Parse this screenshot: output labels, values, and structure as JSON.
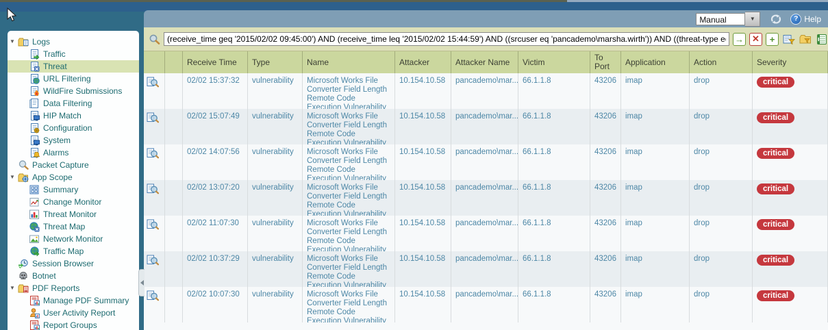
{
  "toolbar": {
    "refresh_mode_value": "Manual",
    "help_label": "Help"
  },
  "filter": {
    "query": "(receive_time geq '2015/02/02 09:45:00') AND (receive_time leq '2015/02/02 15:44:59') AND ((srcuser eq 'pancademo\\marsha.wirth')) AND ((threat-type eq vulnerability)) A",
    "icons": [
      "search-icon",
      "apply-filter-icon",
      "clear-filter-icon",
      "add-filter-icon",
      "save-filter-icon",
      "load-filter-icon",
      "export-icon"
    ]
  },
  "sidebar": {
    "items": [
      {
        "label": "Logs",
        "level": 0,
        "icon": "logs-folder-icon",
        "expander": true,
        "selected": false
      },
      {
        "label": "Traffic",
        "level": 1,
        "icon": "traffic-icon",
        "expander": false,
        "selected": false
      },
      {
        "label": "Threat",
        "level": 1,
        "icon": "threat-icon",
        "expander": false,
        "selected": true
      },
      {
        "label": "URL Filtering",
        "level": 1,
        "icon": "url-filtering-icon",
        "expander": false,
        "selected": false
      },
      {
        "label": "WildFire Submissions",
        "level": 1,
        "icon": "wildfire-icon",
        "expander": false,
        "selected": false
      },
      {
        "label": "Data Filtering",
        "level": 1,
        "icon": "data-filtering-icon",
        "expander": false,
        "selected": false
      },
      {
        "label": "HIP Match",
        "level": 1,
        "icon": "hip-match-icon",
        "expander": false,
        "selected": false
      },
      {
        "label": "Configuration",
        "level": 1,
        "icon": "configuration-icon",
        "expander": false,
        "selected": false
      },
      {
        "label": "System",
        "level": 1,
        "icon": "system-icon",
        "expander": false,
        "selected": false
      },
      {
        "label": "Alarms",
        "level": 1,
        "icon": "alarms-icon",
        "expander": false,
        "selected": false
      },
      {
        "label": "Packet Capture",
        "level": 0,
        "icon": "packet-capture-icon",
        "expander": false,
        "selected": false
      },
      {
        "label": "App Scope",
        "level": 0,
        "icon": "app-scope-folder-icon",
        "expander": true,
        "selected": false
      },
      {
        "label": "Summary",
        "level": 1,
        "icon": "summary-icon",
        "expander": false,
        "selected": false
      },
      {
        "label": "Change Monitor",
        "level": 1,
        "icon": "change-monitor-icon",
        "expander": false,
        "selected": false
      },
      {
        "label": "Threat Monitor",
        "level": 1,
        "icon": "threat-monitor-icon",
        "expander": false,
        "selected": false
      },
      {
        "label": "Threat Map",
        "level": 1,
        "icon": "threat-map-icon",
        "expander": false,
        "selected": false
      },
      {
        "label": "Network Monitor",
        "level": 1,
        "icon": "network-monitor-icon",
        "expander": false,
        "selected": false
      },
      {
        "label": "Traffic Map",
        "level": 1,
        "icon": "traffic-map-icon",
        "expander": false,
        "selected": false
      },
      {
        "label": "Session Browser",
        "level": 0,
        "icon": "session-browser-icon",
        "expander": false,
        "selected": false
      },
      {
        "label": "Botnet",
        "level": 0,
        "icon": "botnet-icon",
        "expander": false,
        "selected": false
      },
      {
        "label": "PDF Reports",
        "level": 0,
        "icon": "pdf-reports-folder-icon",
        "expander": true,
        "selected": false
      },
      {
        "label": "Manage PDF Summary",
        "level": 1,
        "icon": "manage-pdf-summary-icon",
        "expander": false,
        "selected": false
      },
      {
        "label": "User Activity Report",
        "level": 1,
        "icon": "user-activity-report-icon",
        "expander": false,
        "selected": false
      },
      {
        "label": "Report Groups",
        "level": 1,
        "icon": "report-groups-icon",
        "expander": false,
        "selected": false
      }
    ]
  },
  "table": {
    "columns": [
      {
        "key": "detail",
        "label": ""
      },
      {
        "key": "spacer",
        "label": ""
      },
      {
        "key": "receive_time",
        "label": "Receive Time"
      },
      {
        "key": "type",
        "label": "Type"
      },
      {
        "key": "name",
        "label": "Name"
      },
      {
        "key": "attacker",
        "label": "Attacker"
      },
      {
        "key": "attacker_name",
        "label": "Attacker Name"
      },
      {
        "key": "victim",
        "label": "Victim"
      },
      {
        "key": "to_port",
        "label": "To Port"
      },
      {
        "key": "application",
        "label": "Application"
      },
      {
        "key": "action",
        "label": "Action"
      },
      {
        "key": "severity",
        "label": "Severity"
      }
    ],
    "rows": [
      {
        "receive_time": "02/02 15:37:32",
        "type": "vulnerability",
        "name": "Microsoft Works File Converter Field Length Remote Code Execution Vulnerability",
        "attacker": "10.154.10.58",
        "attacker_name": "pancademo\\mar...",
        "victim": "66.1.1.8",
        "to_port": "43206",
        "application": "imap",
        "action": "drop",
        "severity": "critical"
      },
      {
        "receive_time": "02/02 15:07:49",
        "type": "vulnerability",
        "name": "Microsoft Works File Converter Field Length Remote Code Execution Vulnerability",
        "attacker": "10.154.10.58",
        "attacker_name": "pancademo\\mar...",
        "victim": "66.1.1.8",
        "to_port": "43206",
        "application": "imap",
        "action": "drop",
        "severity": "critical"
      },
      {
        "receive_time": "02/02 14:07:56",
        "type": "vulnerability",
        "name": "Microsoft Works File Converter Field Length Remote Code Execution Vulnerability",
        "attacker": "10.154.10.58",
        "attacker_name": "pancademo\\mar...",
        "victim": "66.1.1.8",
        "to_port": "43206",
        "application": "imap",
        "action": "drop",
        "severity": "critical"
      },
      {
        "receive_time": "02/02 13:07:20",
        "type": "vulnerability",
        "name": "Microsoft Works File Converter Field Length Remote Code Execution Vulnerability",
        "attacker": "10.154.10.58",
        "attacker_name": "pancademo\\mar...",
        "victim": "66.1.1.8",
        "to_port": "43206",
        "application": "imap",
        "action": "drop",
        "severity": "critical"
      },
      {
        "receive_time": "02/02 11:07:30",
        "type": "vulnerability",
        "name": "Microsoft Works File Converter Field Length Remote Code Execution Vulnerability",
        "attacker": "10.154.10.58",
        "attacker_name": "pancademo\\mar...",
        "victim": "66.1.1.8",
        "to_port": "43206",
        "application": "imap",
        "action": "drop",
        "severity": "critical"
      },
      {
        "receive_time": "02/02 10:37:29",
        "type": "vulnerability",
        "name": "Microsoft Works File Converter Field Length Remote Code Execution Vulnerability",
        "attacker": "10.154.10.58",
        "attacker_name": "pancademo\\mar...",
        "victim": "66.1.1.8",
        "to_port": "43206",
        "application": "imap",
        "action": "drop",
        "severity": "critical"
      },
      {
        "receive_time": "02/02 10:07:30",
        "type": "vulnerability",
        "name": "Microsoft Works File Converter Field Length Remote Code Execution Vulnerability",
        "attacker": "10.154.10.58",
        "attacker_name": "pancademo\\mar...",
        "victim": "66.1.1.8",
        "to_port": "43206",
        "application": "imap",
        "action": "drop",
        "severity": "critical"
      }
    ]
  },
  "colors": {
    "severity_critical_bg": "#c5383e",
    "accent_teal": "#306b86",
    "header_green": "#cbd79e",
    "link_text": "#4d87a6"
  }
}
